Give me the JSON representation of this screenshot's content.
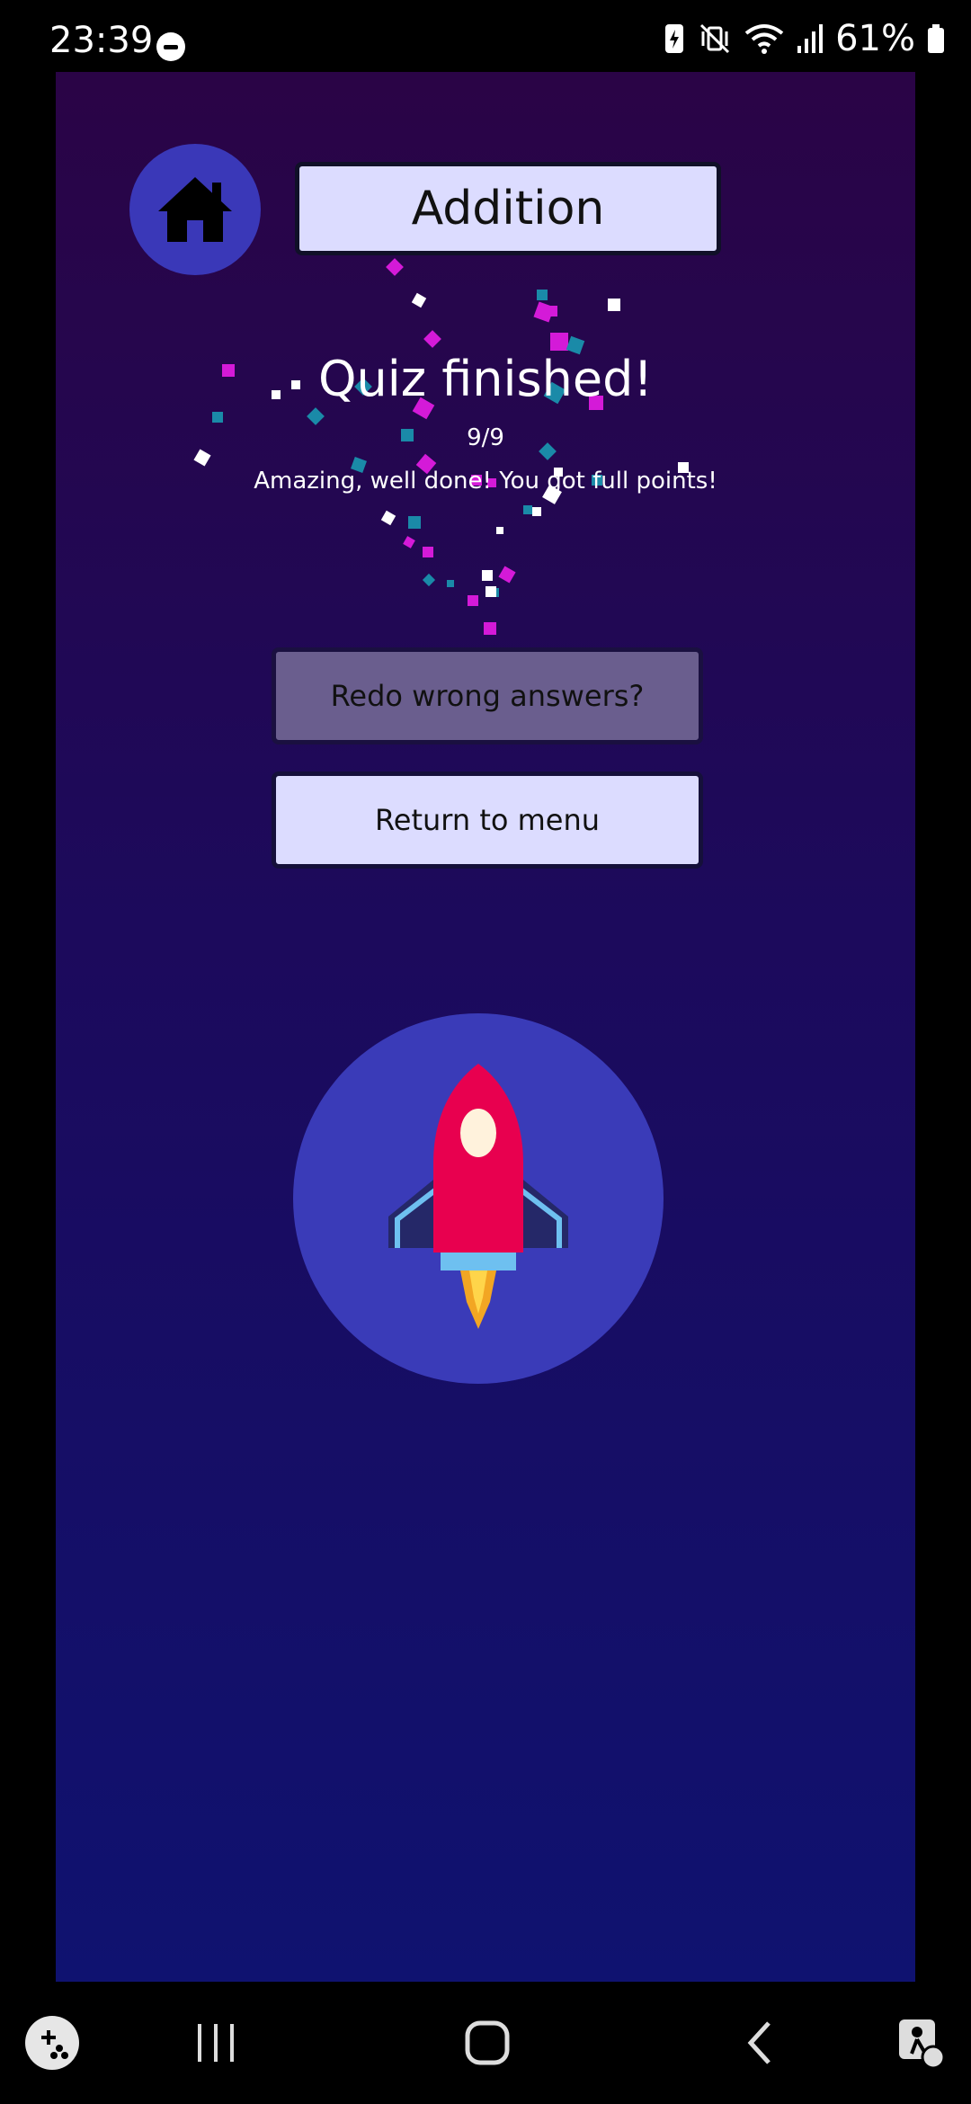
{
  "status_bar": {
    "time": "23:39",
    "battery_percent": "61%",
    "icons": [
      "do-not-disturb-icon",
      "battery-saver-icon",
      "vibrate-mute-icon",
      "wifi-icon",
      "signal-icon",
      "battery-icon"
    ]
  },
  "header": {
    "home_icon": "home-icon",
    "title": "Addition"
  },
  "result": {
    "heading": "Quiz finished!",
    "score": "9/9",
    "message": "Amazing, well done! You got full points!"
  },
  "buttons": {
    "redo_label": "Redo wrong answers?",
    "menu_label": "Return to menu"
  },
  "illustration": {
    "icon": "rocket-icon"
  },
  "nav_bar": {
    "icons": [
      "game-launcher-icon",
      "recent-apps-icon",
      "home-nav-icon",
      "back-icon",
      "accessibility-icon"
    ]
  },
  "colors": {
    "background_top": "#2a0446",
    "background_bottom": "#0f1270",
    "accent_circle": "#3a3bb8",
    "light_button": "#dcdcff",
    "disabled_button": "#6a5e8e",
    "confetti_magenta": "#d41ad8",
    "confetti_teal": "#1a8aa8",
    "confetti_white": "#ffffff"
  }
}
